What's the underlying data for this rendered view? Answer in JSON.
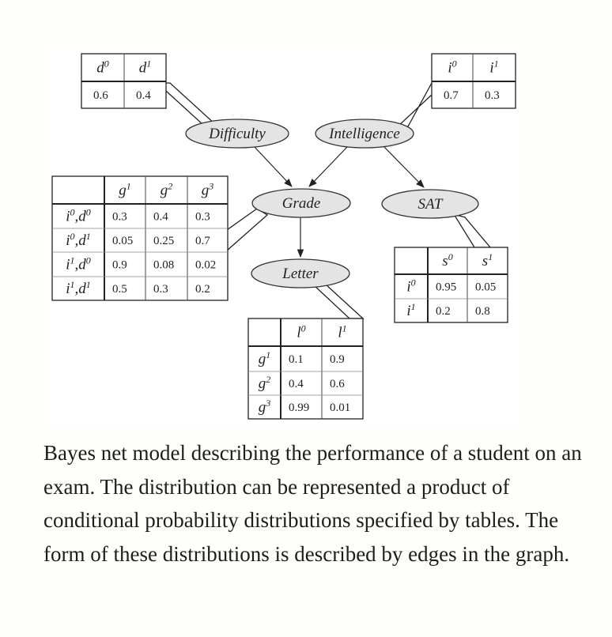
{
  "nodes": {
    "difficulty": "Difficulty",
    "intelligence": "Intelligence",
    "grade": "Grade",
    "sat": "SAT",
    "letter": "Letter"
  },
  "cpts": {
    "difficulty": {
      "headers": [
        [
          "d",
          "0"
        ],
        [
          "d",
          "1"
        ]
      ],
      "values": [
        "0.6",
        "0.4"
      ]
    },
    "intelligence": {
      "headers": [
        [
          "i",
          "0"
        ],
        [
          "i",
          "1"
        ]
      ],
      "values": [
        "0.7",
        "0.3"
      ]
    },
    "grade": {
      "headers": [
        [
          "g",
          "1"
        ],
        [
          "g",
          "2"
        ],
        [
          "g",
          "3"
        ]
      ],
      "rows": [
        {
          "label": [
            [
              "i",
              "0"
            ],
            [
              "d",
              "0"
            ]
          ],
          "values": [
            "0.3",
            "0.4",
            "0.3"
          ]
        },
        {
          "label": [
            [
              "i",
              "0"
            ],
            [
              "d",
              "1"
            ]
          ],
          "values": [
            "0.05",
            "0.25",
            "0.7"
          ]
        },
        {
          "label": [
            [
              "i",
              "1"
            ],
            [
              "d",
              "0"
            ]
          ],
          "values": [
            "0.9",
            "0.08",
            "0.02"
          ]
        },
        {
          "label": [
            [
              "i",
              "1"
            ],
            [
              "d",
              "1"
            ]
          ],
          "values": [
            "0.5",
            "0.3",
            "0.2"
          ]
        }
      ]
    },
    "sat": {
      "headers": [
        [
          "s",
          "0"
        ],
        [
          "s",
          "1"
        ]
      ],
      "rows": [
        {
          "label": [
            [
              "i",
              "0"
            ]
          ],
          "values": [
            "0.95",
            "0.05"
          ]
        },
        {
          "label": [
            [
              "i",
              "1"
            ]
          ],
          "values": [
            "0.2",
            "0.8"
          ]
        }
      ]
    },
    "letter": {
      "headers": [
        [
          "l",
          "0"
        ],
        [
          "l",
          "1"
        ]
      ],
      "rows": [
        {
          "label": [
            [
              "g",
              "1"
            ]
          ],
          "values": [
            "0.1",
            "0.9"
          ]
        },
        {
          "label": [
            [
              "g",
              "2"
            ]
          ],
          "values": [
            "0.4",
            "0.6"
          ]
        },
        {
          "label": [
            [
              "g",
              "3"
            ]
          ],
          "values": [
            "0.99",
            "0.01"
          ]
        }
      ]
    }
  },
  "caption": "Bayes net model describing the performance of a student on an exam. The distribution can be represented a product of conditional probability distributions specified by tables. The form of these distributions is described by edges in the graph."
}
